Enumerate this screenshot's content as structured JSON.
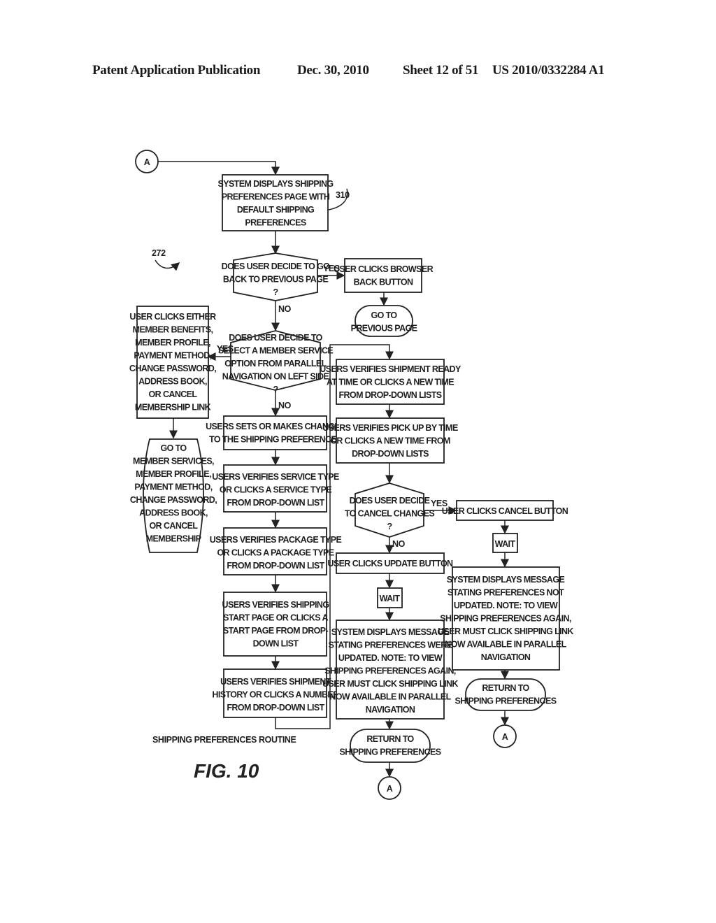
{
  "header": {
    "publication": "Patent Application Publication",
    "date": "Dec. 30, 2010",
    "sheet": "Sheet 12 of 51",
    "number": "US 2010/0332284 A1"
  },
  "figure": {
    "ref_main": "272",
    "ref_box": "310",
    "caption": "SHIPPING PREFERENCES ROUTINE",
    "label": "FIG. 10"
  },
  "connectors": {
    "start": "A",
    "end_middle": "A",
    "end_right": "A"
  },
  "labels": {
    "yes": "YES",
    "no": "NO"
  },
  "nodes": {
    "n310": [
      "SYSTEM DISPLAYS SHIPPING",
      "PREFERENCES PAGE WITH",
      "DEFAULT SHIPPING",
      "PREFERENCES"
    ],
    "d_back": [
      "DOES USER DECIDE TO GO",
      "BACK TO PREVIOUS PAGE",
      "?"
    ],
    "browser_back": [
      "USER CLICKS BROWSER",
      "BACK BUTTON"
    ],
    "goto_prev": [
      "GO TO",
      "PREVIOUS PAGE"
    ],
    "d_member": [
      "DOES USER DECIDE TO",
      "SELECT A MEMBER SERVICE",
      "OPTION FROM PARALLEL",
      "NAVIGATION ON LEFT SIDE",
      "?"
    ],
    "member_click": [
      "USER CLICKS EITHER",
      "MEMBER BENEFITS,",
      "MEMBER PROFILE,",
      "PAYMENT METHOD,",
      "CHANGE PASSWORD,",
      "ADDRESS BOOK,",
      "OR CANCEL",
      "MEMBERSHIP LINK"
    ],
    "goto_member": [
      "GO TO",
      "MEMBER SERVICES,",
      "MEMBER PROFILE,",
      "PAYMENT METHOD,",
      "CHANGE PASSWORD,",
      "ADDRESS BOOK,",
      "OR CANCEL",
      "MEMBERSHIP"
    ],
    "sets_changes": [
      "USERS SETS OR MAKES CHANGES",
      "TO THE SHIPPING PREFERENCES"
    ],
    "service_type": [
      "USERS VERIFIES SERVICE TYPE",
      "OR CLICKS A SERVICE TYPE",
      "FROM DROP-DOWN LIST"
    ],
    "package_type": [
      "USERS VERIFIES PACKAGE TYPE",
      "OR CLICKS A PACKAGE TYPE",
      "FROM DROP-DOWN LIST"
    ],
    "start_page": [
      "USERS VERIFIES SHIPPING",
      "START PAGE OR CLICKS A",
      "START PAGE FROM DROP-",
      "DOWN LIST"
    ],
    "ship_history": [
      "USERS VERIFIES SHIPMENT",
      "HISTORY OR CLICKS A NUMBER",
      "FROM DROP-DOWN LIST"
    ],
    "ready_time": [
      "USERS VERIFIES SHIPMENT READY",
      "AT TIME OR CLICKS A NEW TIME",
      "FROM DROP-DOWN LISTS"
    ],
    "pickup_time": [
      "USERS VERIFIES PICK UP BY TIME",
      "OR CLICKS A NEW TIME FROM",
      "DROP-DOWN LISTS"
    ],
    "d_cancel": [
      "DOES USER DECIDE",
      "TO CANCEL CHANGES",
      "?"
    ],
    "update_btn": [
      "USER CLICKS UPDATE BUTTON"
    ],
    "wait_mid": [
      "WAIT"
    ],
    "msg_updated": [
      "SYSTEM DISPLAYS MESSAGE",
      "STATING PREFERENCES WERE",
      "UPDATED. NOTE: TO VIEW",
      "SHIPPING PREFERENCES AGAIN,",
      "USER MUST CLICK SHIPPING LINK",
      "NOW AVAILABLE IN PARALLEL",
      "NAVIGATION"
    ],
    "return_mid": [
      "RETURN TO",
      "SHIPPING PREFERENCES"
    ],
    "cancel_btn": [
      "USER CLICKS CANCEL BUTTON"
    ],
    "wait_right": [
      "WAIT"
    ],
    "msg_not_updated": [
      "SYSTEM DISPLAYS MESSAGE",
      "STATING PREFERENCES NOT",
      "UPDATED. NOTE: TO VIEW",
      "SHIPPING PREFERENCES AGAIN,",
      "USER MUST CLICK SHIPPING LINK",
      "NOW AVAILABLE IN PARALLEL",
      "NAVIGATION"
    ],
    "return_right": [
      "RETURN TO",
      "SHIPPING PREFERENCES"
    ]
  }
}
